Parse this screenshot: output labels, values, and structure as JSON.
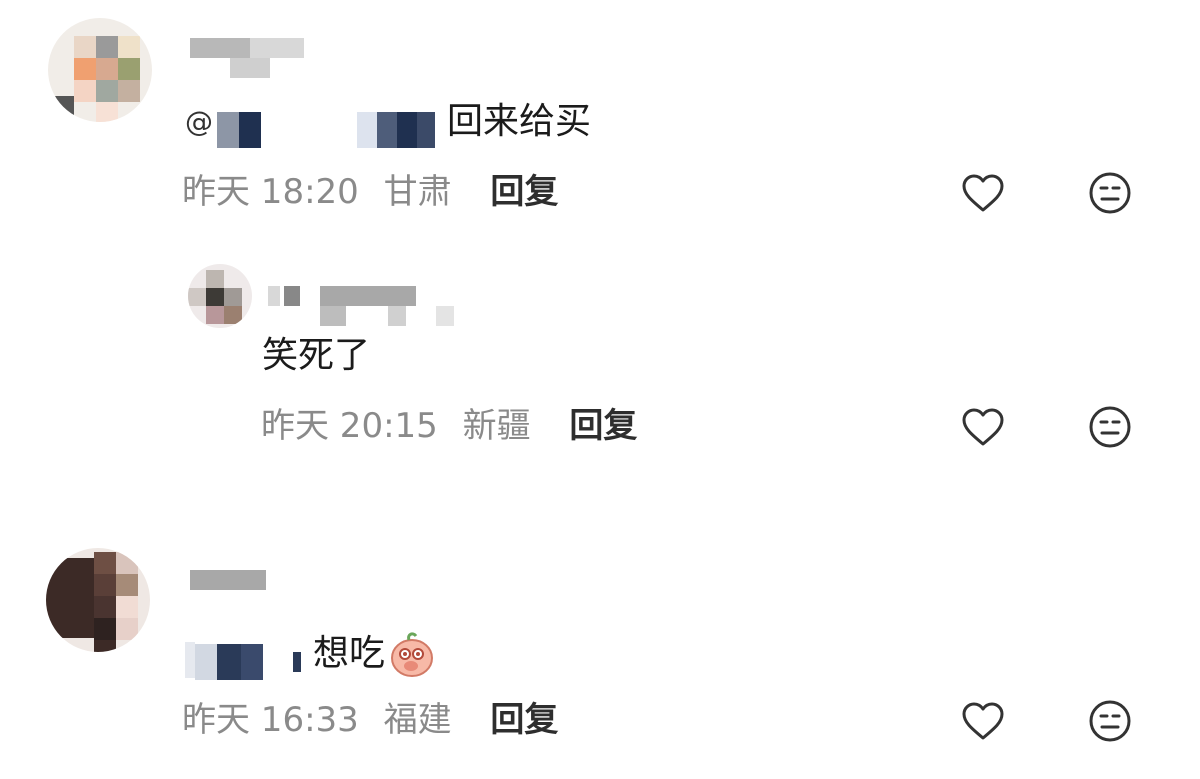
{
  "comments": [
    {
      "mention_prefix": "@",
      "text": "回来给买",
      "time": "昨天 18:20",
      "location": "甘肃",
      "reply_label": "回复"
    },
    {
      "text": "笑死了",
      "time": "昨天 20:15",
      "location": "新疆",
      "reply_label": "回复"
    },
    {
      "text": "想吃",
      "emoji": "peach-face-emoji",
      "time": "昨天 16:33",
      "location": "福建",
      "reply_label": "回复"
    }
  ],
  "icons": {
    "like": "heart-outline-icon",
    "dislike": "neutral-face-icon"
  },
  "colors": {
    "text": "#1b1b1b",
    "meta": "#8a8a8a",
    "reply": "#2e2e2e",
    "icon": "#333333"
  }
}
